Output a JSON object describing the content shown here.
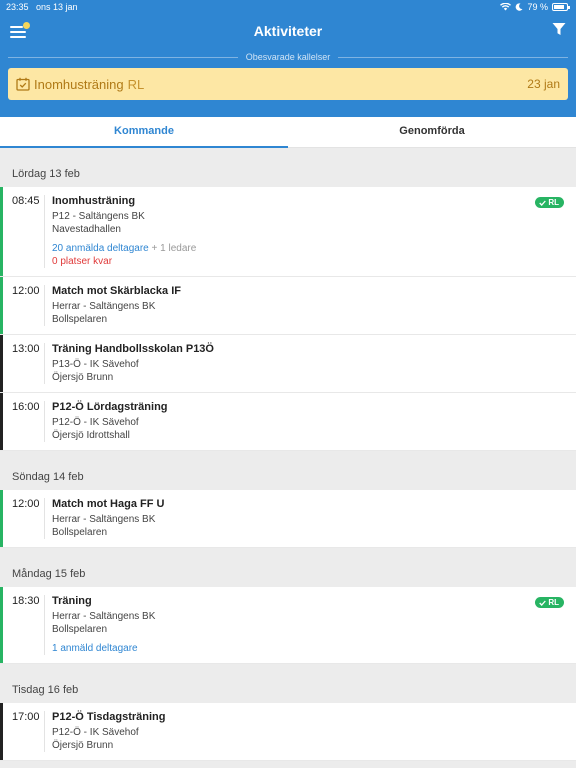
{
  "status": {
    "time": "23:35",
    "date": "ons 13 jan",
    "battery": "79 %"
  },
  "header": {
    "title": "Aktiviteter"
  },
  "unanswered": {
    "label": "Obesvarade kallelser",
    "item": {
      "name": "Inomhusträning",
      "tag": "RL",
      "date": "23 jan"
    }
  },
  "tabs": [
    {
      "label": "Kommande",
      "active": true
    },
    {
      "label": "Genomförda",
      "active": false
    }
  ],
  "days": [
    {
      "label": "Lördag 13 feb",
      "events": [
        {
          "time": "08:45",
          "name": "Inomhusträning",
          "team": "P12 - Saltängens BK",
          "place": "Navestadhallen",
          "participants": "20 anmälda deltagare",
          "leaders": " + 1 ledare",
          "spots": "0 platser kvar",
          "badge": "RL",
          "color": "#28b463"
        },
        {
          "time": "12:00",
          "name": "Match mot Skärblacka IF",
          "team": "Herrar - Saltängens BK",
          "place": "Bollspelaren",
          "color": "#28b463"
        },
        {
          "time": "13:00",
          "name": "Träning Handbollsskolan P13Ö",
          "team": "P13-Ö - IK Sävehof",
          "place": "Öjersjö Brunn",
          "color": "#222222"
        },
        {
          "time": "16:00",
          "name": "P12-Ö Lördagsträning",
          "team": "P12-Ö - IK Sävehof",
          "place": "Öjersjö Idrottshall",
          "color": "#222222"
        }
      ]
    },
    {
      "label": "Söndag 14 feb",
      "events": [
        {
          "time": "12:00",
          "name": "Match mot Haga FF U",
          "team": "Herrar - Saltängens BK",
          "place": "Bollspelaren",
          "color": "#28b463"
        }
      ]
    },
    {
      "label": "Måndag 15 feb",
      "events": [
        {
          "time": "18:30",
          "name": "Träning",
          "team": "Herrar - Saltängens BK",
          "place": "Bollspelaren",
          "participants": "1 anmäld deltagare",
          "badge": "RL",
          "color": "#28b463"
        }
      ]
    },
    {
      "label": "Tisdag 16 feb",
      "events": [
        {
          "time": "17:00",
          "name": "P12-Ö Tisdagsträning",
          "team": "P12-Ö - IK Sävehof",
          "place": "Öjersjö Brunn",
          "color": "#222222"
        }
      ]
    }
  ],
  "colors": {
    "primary": "#2f86d2",
    "invite_bg": "#fde7a4",
    "green": "#28b463",
    "red": "#e03a3a"
  }
}
